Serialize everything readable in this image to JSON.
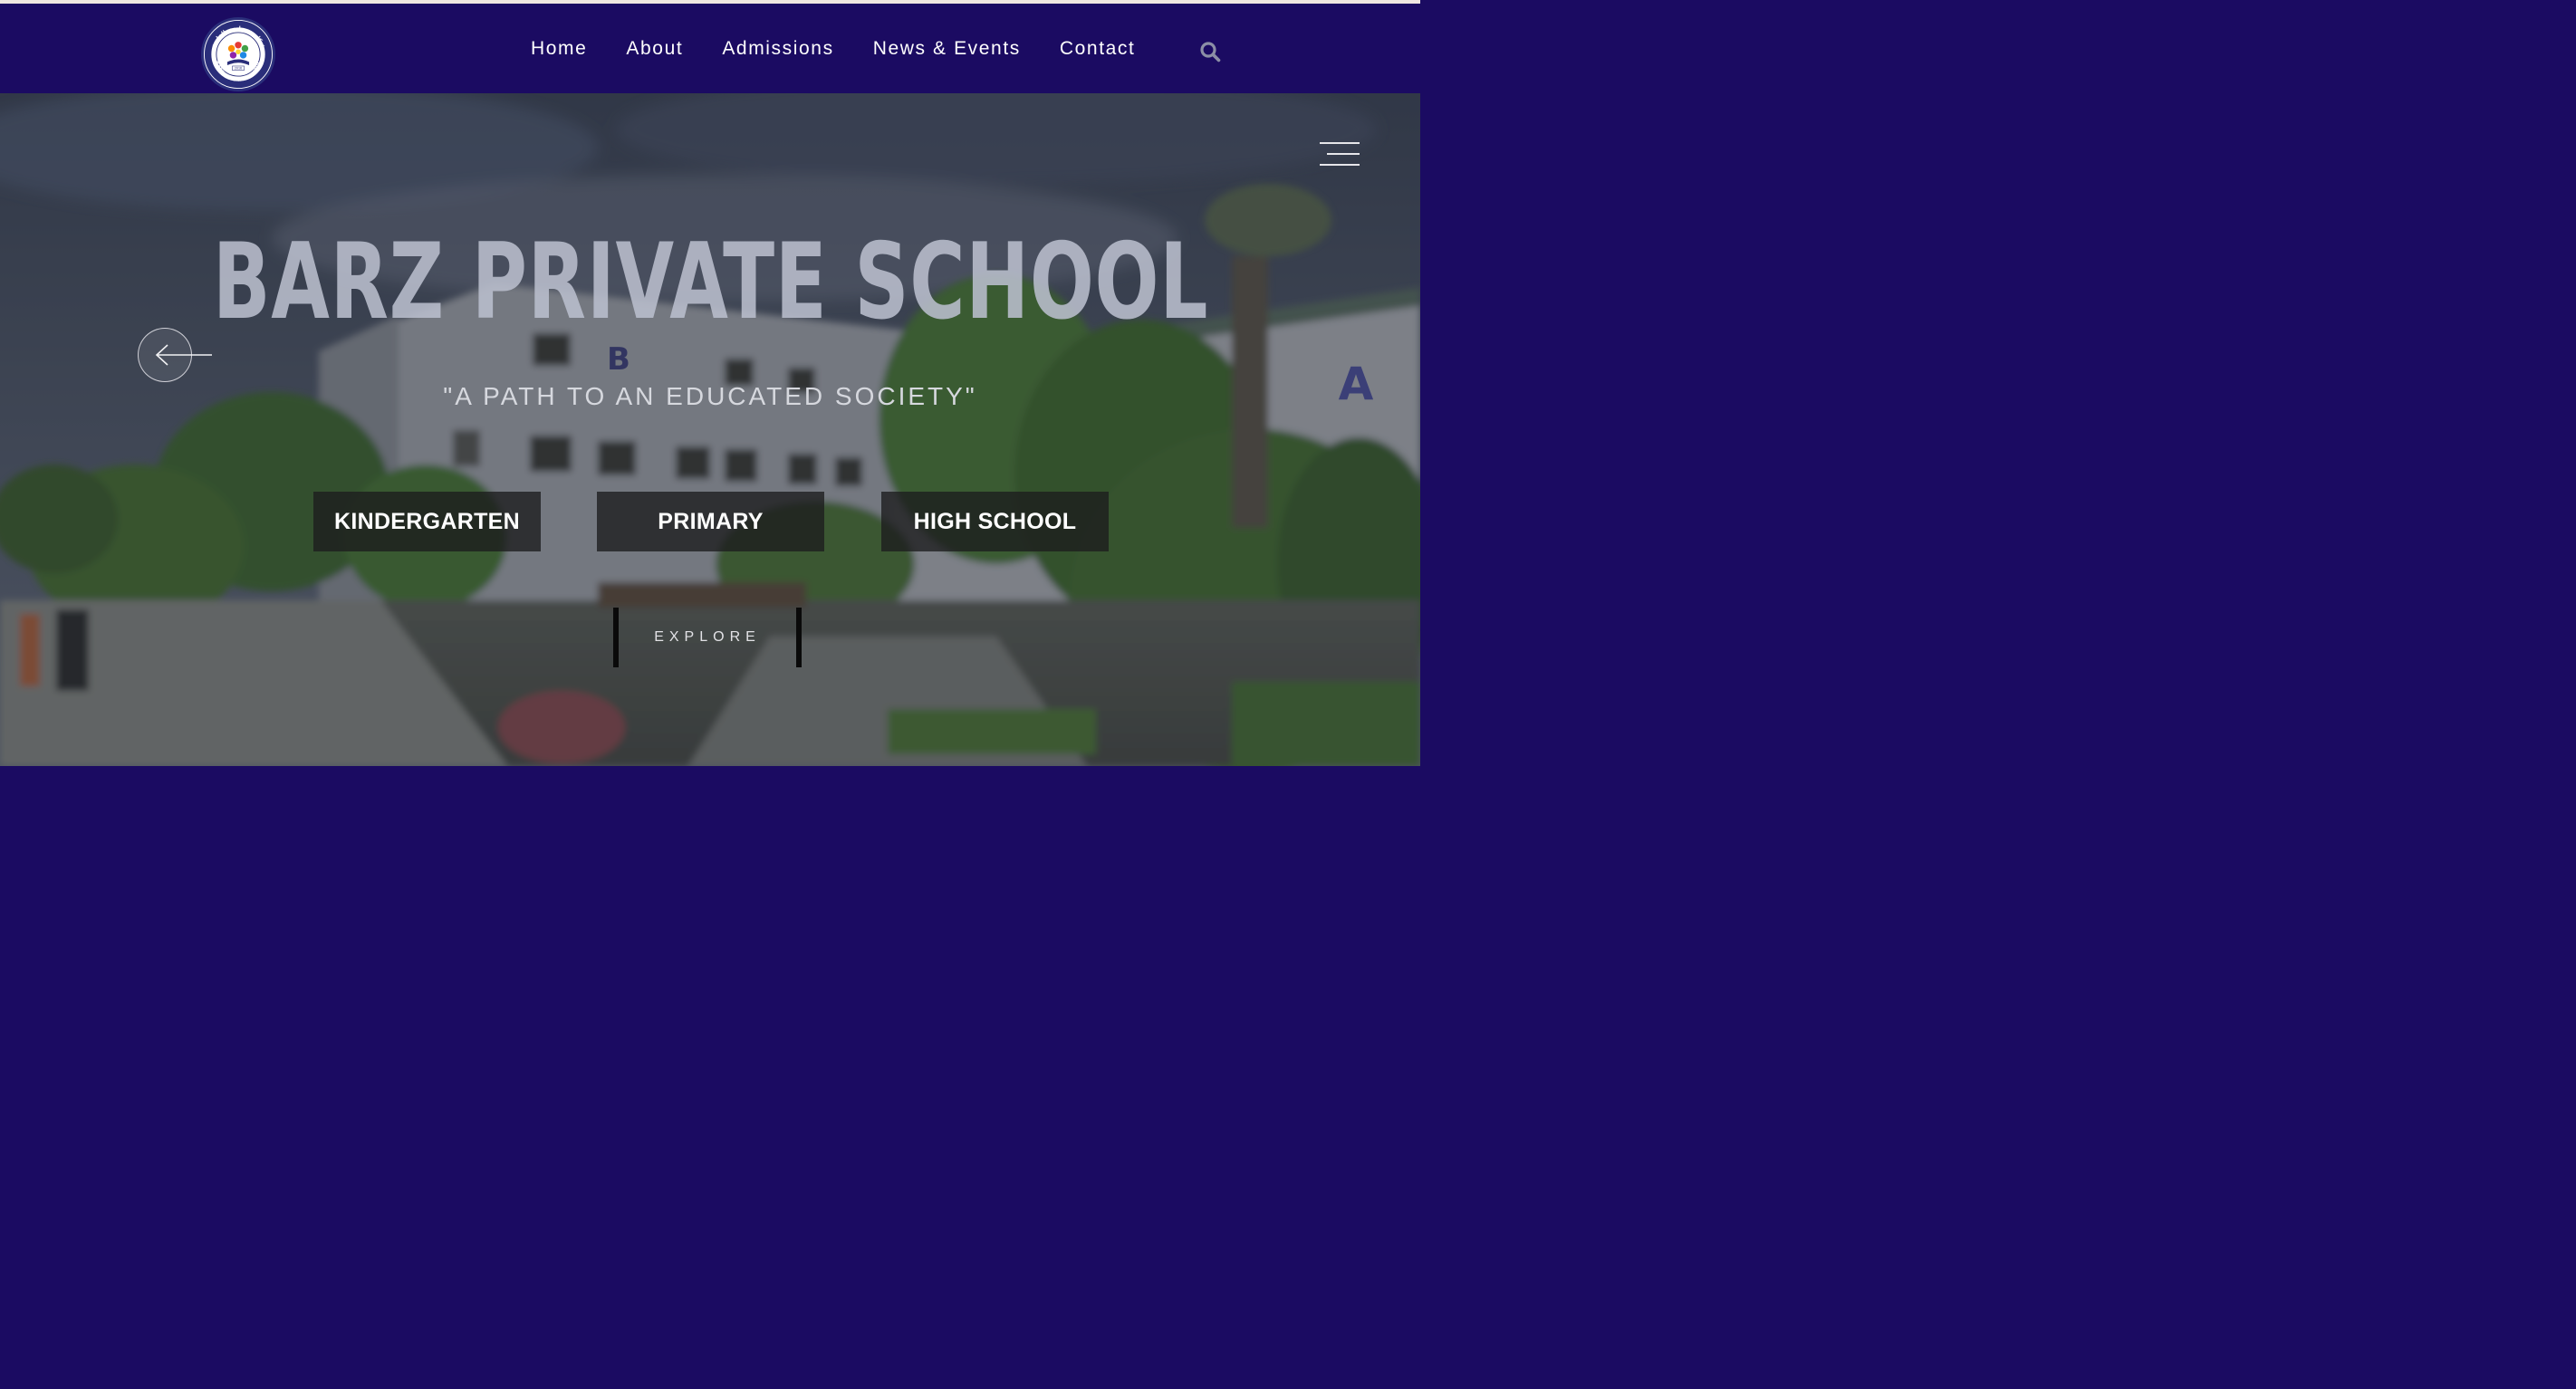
{
  "header": {
    "logo_text_top": "ئەكاديمى بارزى الخاصة",
    "logo_text_bottom": "BARZ PRIVATE SCHOOL",
    "logo_year": "2016",
    "nav": [
      {
        "label": "Home"
      },
      {
        "label": "About"
      },
      {
        "label": "Admissions"
      },
      {
        "label": "News & Events"
      },
      {
        "label": "Contact"
      }
    ],
    "search_icon": "search-icon"
  },
  "hero": {
    "title": "BARZ PRIVATE SCHOOL",
    "subtitle": "\"A PATH TO AN EDUCATED SOCIETY\"",
    "building_letters": [
      "B",
      "A"
    ],
    "buttons": [
      {
        "label": "KINDERGARTEN"
      },
      {
        "label": "PRIMARY"
      },
      {
        "label": "HIGH SCHOOL"
      }
    ],
    "explore_label": "EXPLORE",
    "menu_icon": "hamburger-menu-icon",
    "prev_icon": "arrow-left-icon"
  },
  "colors": {
    "nav_background": "#1b0b62",
    "nav_text": "#ffffff",
    "search_icon": "#8c8fa6",
    "button_background": "#1c1c1e"
  }
}
